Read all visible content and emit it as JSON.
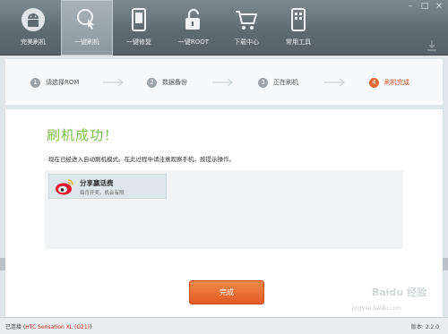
{
  "toolbar": {
    "items": [
      {
        "label": "完美刷机",
        "icon": "android-logo-icon"
      },
      {
        "label": "一键刷机",
        "icon": "flash-touch-icon"
      },
      {
        "label": "一键修复",
        "icon": "phone-repair-icon"
      },
      {
        "label": "一键ROOT",
        "icon": "unlock-icon"
      },
      {
        "label": "下载中心",
        "icon": "cart-icon"
      },
      {
        "label": "常用工具",
        "icon": "toolbox-phone-icon"
      }
    ]
  },
  "steps": [
    {
      "num": "1",
      "label": "请选择ROM"
    },
    {
      "num": "2",
      "label": "数据备份"
    },
    {
      "num": "3",
      "label": "正在刷机"
    },
    {
      "num": "4",
      "label": "刷机完成"
    }
  ],
  "main": {
    "title": "刷机成功！",
    "description": "现在已经进入自动刷机模式。在此过程中请注意观察手机，按提示操作。",
    "weibo": {
      "title": "分享赢话费",
      "subtitle": "每月开奖，机会有限"
    },
    "finish_label": "完成"
  },
  "status": {
    "connected_prefix": "已连接 (",
    "device": "HTC Sensation XL (G21)",
    "connected_suffix": ")",
    "version": "版本: 2.2.0"
  },
  "watermark": {
    "text": "Baidu 经验",
    "sub": "jingyan.baidu.com"
  },
  "colors": {
    "accent": "#e25a24",
    "success": "#7cc04a",
    "toolbar": "#5f6b73"
  }
}
